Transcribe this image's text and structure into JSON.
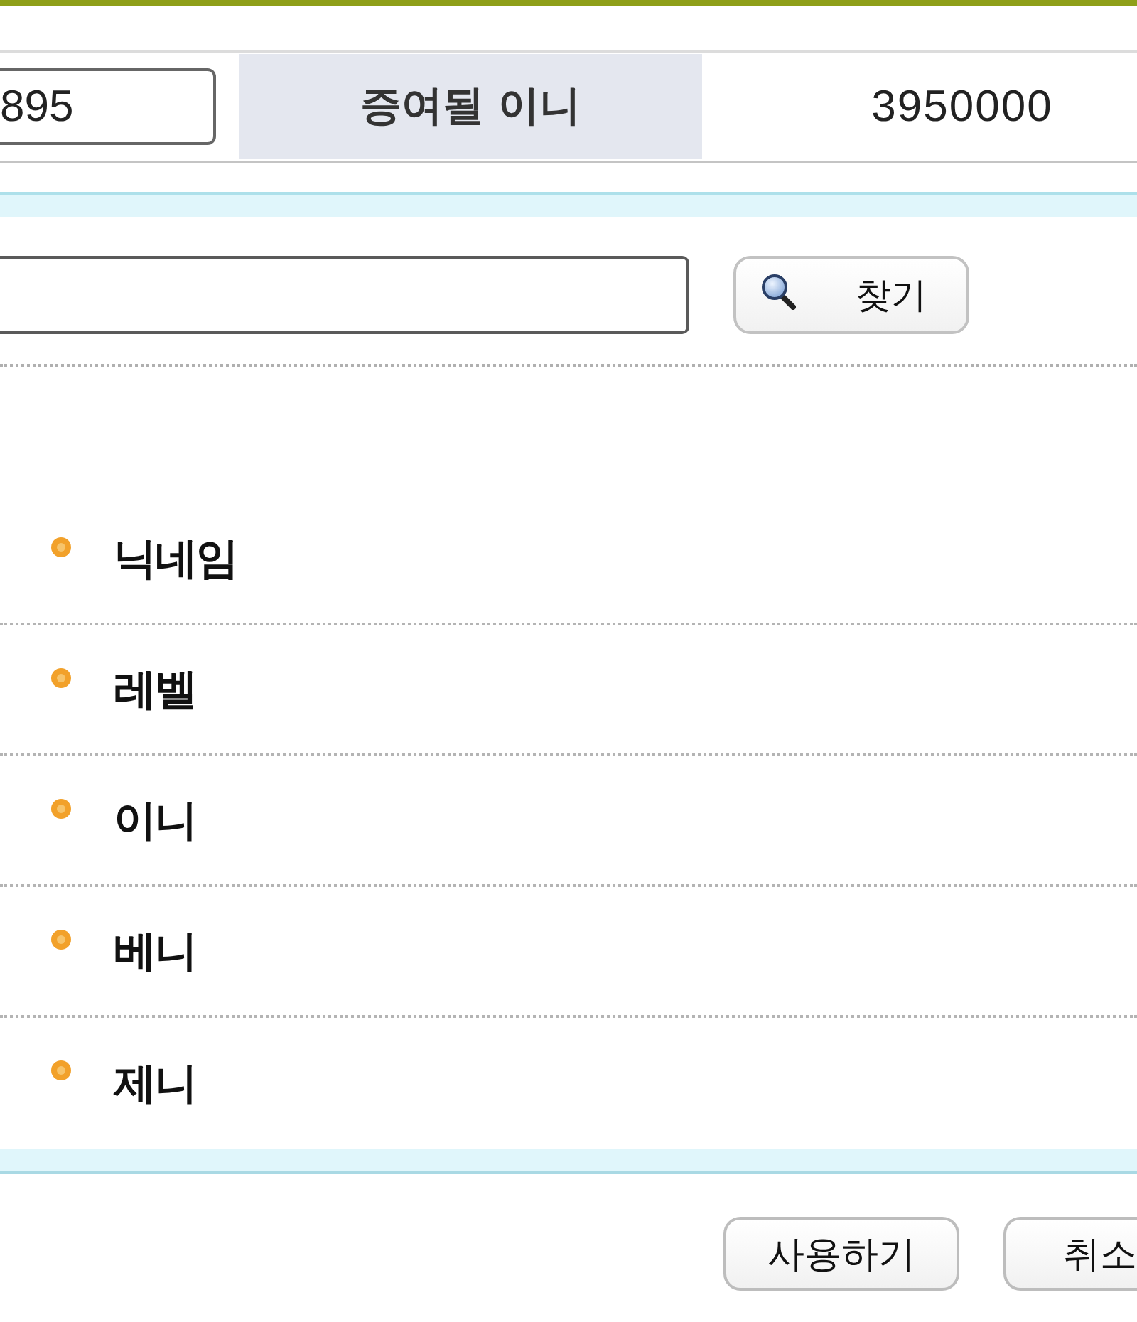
{
  "gift_row": {
    "id_field": {
      "value": "895"
    },
    "label": "증여될 이니",
    "amount": "3950000"
  },
  "search": {
    "button": "찾기"
  },
  "info_list": [
    {
      "label": "닉네임"
    },
    {
      "label": "레벨"
    },
    {
      "label": "이니"
    },
    {
      "label": "베니"
    },
    {
      "label": "제니"
    }
  ],
  "buttons": [
    {
      "label": "사용하기"
    },
    {
      "label": "취소"
    }
  ]
}
